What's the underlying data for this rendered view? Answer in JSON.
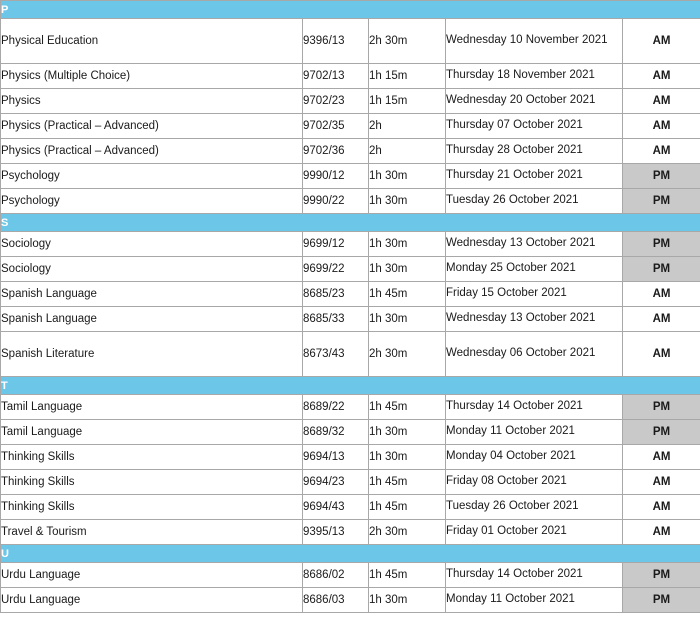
{
  "document": {
    "type": "exam-timetable",
    "colors": {
      "section_header_bg": "#6cc6e8",
      "section_header_text": "#ffffff",
      "pm_cell_bg": "#c9c9c9",
      "am_cell_bg": "#ffffff",
      "border": "#a8a8a8",
      "text": "#1a1a1a"
    }
  },
  "sections": [
    {
      "letter": "P",
      "rows": [
        {
          "subject": "Physical Education",
          "code": "9396/13",
          "duration": "2h 30m",
          "date": "Wednesday 10 November 2021",
          "session": "AM",
          "tall": true
        },
        {
          "subject": "Physics (Multiple Choice)",
          "code": "9702/13",
          "duration": "1h 15m",
          "date": "Thursday 18 November 2021",
          "session": "AM",
          "tall": false
        },
        {
          "subject": "Physics",
          "code": "9702/23",
          "duration": "1h 15m",
          "date": "Wednesday 20 October 2021",
          "session": "AM",
          "tall": false
        },
        {
          "subject": "Physics (Practical – Advanced)",
          "code": "9702/35",
          "duration": "2h",
          "date": "Thursday 07 October 2021",
          "session": "AM",
          "tall": false
        },
        {
          "subject": "Physics (Practical – Advanced)",
          "code": "9702/36",
          "duration": "2h",
          "date": "Thursday 28 October 2021",
          "session": "AM",
          "tall": false
        },
        {
          "subject": "Psychology",
          "code": "9990/12",
          "duration": "1h 30m",
          "date": "Thursday 21 October 2021",
          "session": "PM",
          "tall": false
        },
        {
          "subject": "Psychology",
          "code": "9990/22",
          "duration": "1h 30m",
          "date": "Tuesday 26 October 2021",
          "session": "PM",
          "tall": false
        }
      ]
    },
    {
      "letter": "S",
      "rows": [
        {
          "subject": "Sociology",
          "code": "9699/12",
          "duration": "1h 30m",
          "date": "Wednesday 13 October 2021",
          "session": "PM",
          "tall": false
        },
        {
          "subject": "Sociology",
          "code": "9699/22",
          "duration": "1h 30m",
          "date": "Monday 25 October 2021",
          "session": "PM",
          "tall": false
        },
        {
          "subject": "Spanish Language",
          "code": "8685/23",
          "duration": "1h 45m",
          "date": "Friday 15 October 2021",
          "session": "AM",
          "tall": false
        },
        {
          "subject": "Spanish Language",
          "code": "8685/33",
          "duration": "1h 30m",
          "date": "Wednesday 13 October 2021",
          "session": "AM",
          "tall": false
        },
        {
          "subject": "Spanish Literature",
          "code": "8673/43",
          "duration": "2h 30m",
          "date": "Wednesday 06 October 2021",
          "session": "AM",
          "tall": true
        }
      ]
    },
    {
      "letter": "T",
      "rows": [
        {
          "subject": "Tamil Language",
          "code": "8689/22",
          "duration": "1h 45m",
          "date": "Thursday 14 October 2021",
          "session": "PM",
          "tall": false
        },
        {
          "subject": "Tamil Language",
          "code": "8689/32",
          "duration": "1h 30m",
          "date": "Monday 11 October 2021",
          "session": "PM",
          "tall": false
        },
        {
          "subject": "Thinking Skills",
          "code": "9694/13",
          "duration": "1h 30m",
          "date": "Monday 04 October 2021",
          "session": "AM",
          "tall": false
        },
        {
          "subject": "Thinking Skills",
          "code": "9694/23",
          "duration": "1h 45m",
          "date": "Friday 08 October 2021",
          "session": "AM",
          "tall": false
        },
        {
          "subject": "Thinking Skills",
          "code": "9694/43",
          "duration": "1h 45m",
          "date": "Tuesday 26 October 2021",
          "session": "AM",
          "tall": false
        },
        {
          "subject": "Travel & Tourism",
          "code": "9395/13",
          "duration": "2h 30m",
          "date": "Friday 01 October 2021",
          "session": "AM",
          "tall": false
        }
      ]
    },
    {
      "letter": "U",
      "rows": [
        {
          "subject": "Urdu Language",
          "code": "8686/02",
          "duration": "1h 45m",
          "date": "Thursday 14 October 2021",
          "session": "PM",
          "tall": false
        },
        {
          "subject": "Urdu Language",
          "code": "8686/03",
          "duration": "1h 30m",
          "date": "Monday 11 October 2021",
          "session": "PM",
          "tall": false
        }
      ]
    }
  ]
}
